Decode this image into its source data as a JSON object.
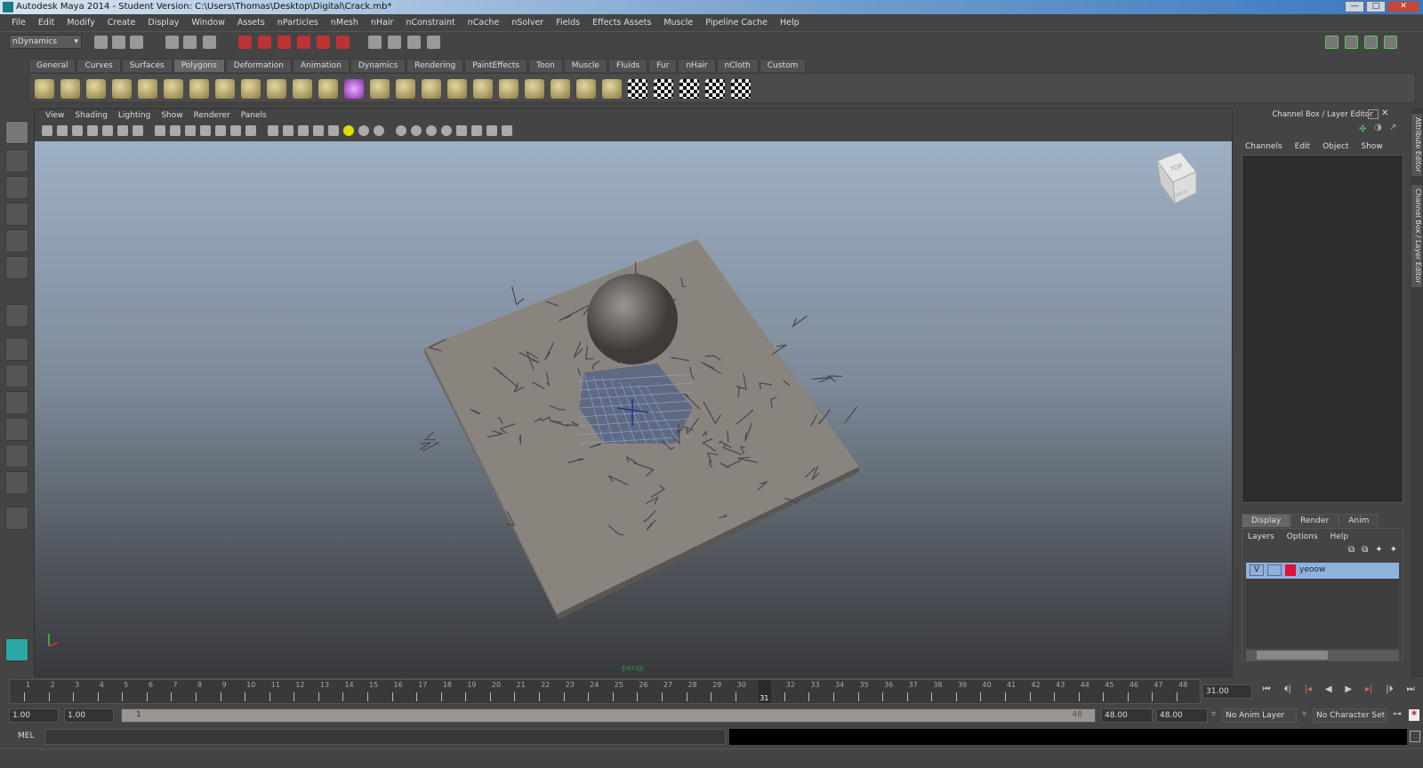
{
  "window": {
    "title": "Autodesk Maya 2014 - Student Version: C:\\Users\\Thomas\\Desktop\\Digital\\Crack.mb*",
    "minimize": "—",
    "maximize": "□",
    "close": "✕"
  },
  "menubar": [
    "File",
    "Edit",
    "Modify",
    "Create",
    "Display",
    "Window",
    "Assets",
    "nParticles",
    "nMesh",
    "nHair",
    "nConstraint",
    "nCache",
    "nSolver",
    "Fields",
    "Effects Assets",
    "Muscle",
    "Pipeline Cache",
    "Help"
  ],
  "statusline": {
    "menu_set": "nDynamics"
  },
  "shelf": {
    "tabs": [
      "General",
      "Curves",
      "Surfaces",
      "Polygons",
      "Deformation",
      "Animation",
      "Dynamics",
      "Rendering",
      "PaintEffects",
      "Toon",
      "Muscle",
      "Fluids",
      "Fur",
      "nHair",
      "nCloth",
      "Custom"
    ],
    "active_tab": "Polygons"
  },
  "viewport": {
    "menus": [
      "View",
      "Shading",
      "Lighting",
      "Show",
      "Renderer",
      "Panels"
    ],
    "camera_label": "persp",
    "viewcube": {
      "top": "TOP",
      "back": "BACK"
    }
  },
  "channel_box": {
    "title": "Channel Box / Layer Editor",
    "menus": [
      "Channels",
      "Edit",
      "Object",
      "Show"
    ]
  },
  "layer_editor": {
    "tabs": [
      "Display",
      "Render",
      "Anim"
    ],
    "active_tab": "Display",
    "menus": [
      "Layers",
      "Options",
      "Help"
    ],
    "layers": [
      {
        "visible": "V",
        "name": "yeoow",
        "color": "#e0103a"
      }
    ]
  },
  "side_tabs": [
    "Attribute Editor",
    "Channel Box / Layer Editor"
  ],
  "timeline": {
    "start": 1,
    "end": 48,
    "current": 31,
    "current_field": "31.00"
  },
  "range": {
    "start_time": "1.00",
    "playback_start": "1.00",
    "slider_start": "1",
    "slider_end": "48",
    "playback_end": "48.00",
    "end_time": "48.00",
    "anim_layer": "No Anim Layer",
    "character_set": "No Character Set"
  },
  "command_line": {
    "label": "MEL"
  },
  "colors": {
    "accent": "#8db2dc",
    "layer": "#e0103a",
    "bg": "#444444"
  }
}
